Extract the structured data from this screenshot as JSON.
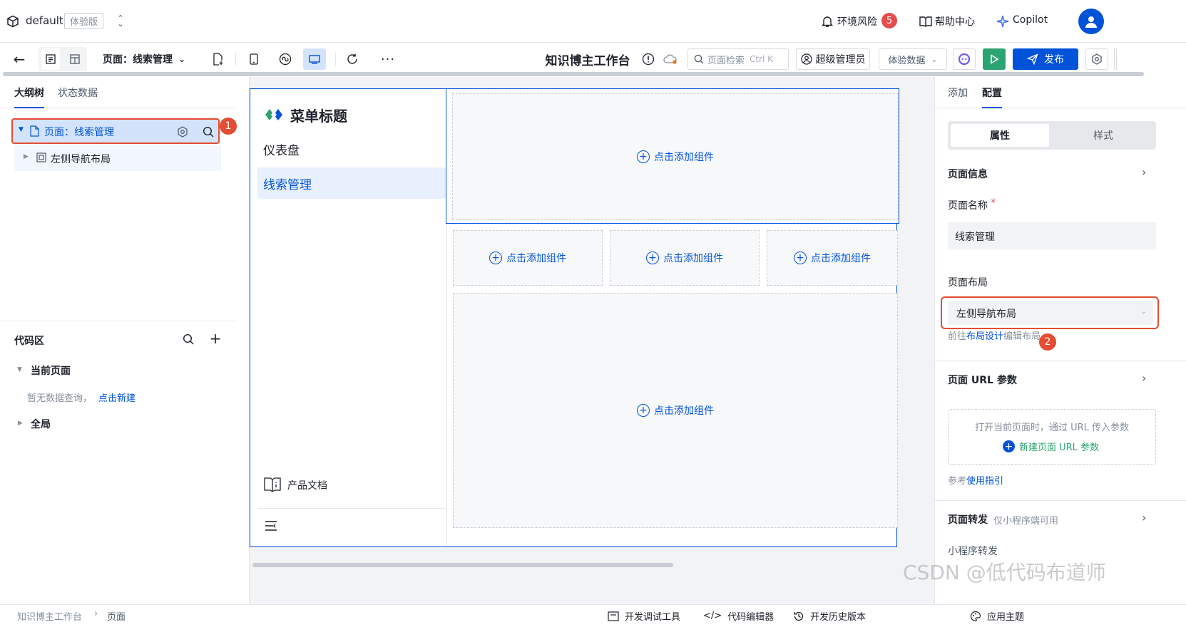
{
  "topbar": {
    "app_name": "default",
    "app_tag": "体验版",
    "env_risk_label": "环境风险",
    "env_risk_count": "5",
    "help_label": "帮助中心",
    "copilot_label": "Copilot"
  },
  "toolbar": {
    "page_selector": "页面：线索管理",
    "app_title": "知识博主工作台",
    "search_placeholder": "页面检索",
    "search_shortcut": "Ctrl K",
    "role_label": "超级管理员",
    "data_env_label": "体验数据",
    "publish_label": "发布"
  },
  "left": {
    "tabs": [
      "大纲树",
      "状态数据"
    ],
    "tree": {
      "page_label": "页面：线索管理",
      "child_label": "左侧导航布局"
    },
    "annotation_1": "1",
    "code_area": {
      "title": "代码区",
      "current_page": "当前页面",
      "empty_text": "暂无数据查询，",
      "create_link": "点击新建",
      "global": "全局"
    }
  },
  "canvas": {
    "menu_title": "菜单标题",
    "nav_items": [
      "仪表盘",
      "线索管理"
    ],
    "docs_label": "产品文档",
    "add_component": "点击添加组件"
  },
  "right": {
    "tabs": [
      "添加",
      "配置"
    ],
    "subtabs": [
      "属性",
      "样式"
    ],
    "page_info": "页面信息",
    "page_name_label": "页面名称",
    "page_name_value": "线索管理",
    "page_layout_label": "页面布局",
    "page_layout_value": "左侧导航布局",
    "layout_hint_prefix": "前往",
    "layout_hint_link": "布局设计",
    "layout_hint_suffix": "编辑布局",
    "annotation_2": "2",
    "url_params_title": "页面 URL 参数",
    "url_params_desc": "打开当前页面时，通过 URL 传入参数",
    "url_params_new": "新建页面 URL 参数",
    "guide_prefix": "参考",
    "guide_link": "使用指引",
    "forward_title": "页面转发",
    "forward_note": "仅小程序端可用",
    "mini_forward": "小程序转发"
  },
  "statusbar": {
    "breadcrumb": [
      "知识博主工作台",
      "页面"
    ],
    "dev_tools": "开发调试工具",
    "code_editor": "代码编辑器",
    "history": "开发历史版本",
    "theme": "应用主题"
  },
  "watermark": "CSDN @低代码布道师",
  "colors": {
    "primary": "#0052d9",
    "annotation": "#e34d33",
    "run_green": "#2ba471"
  }
}
